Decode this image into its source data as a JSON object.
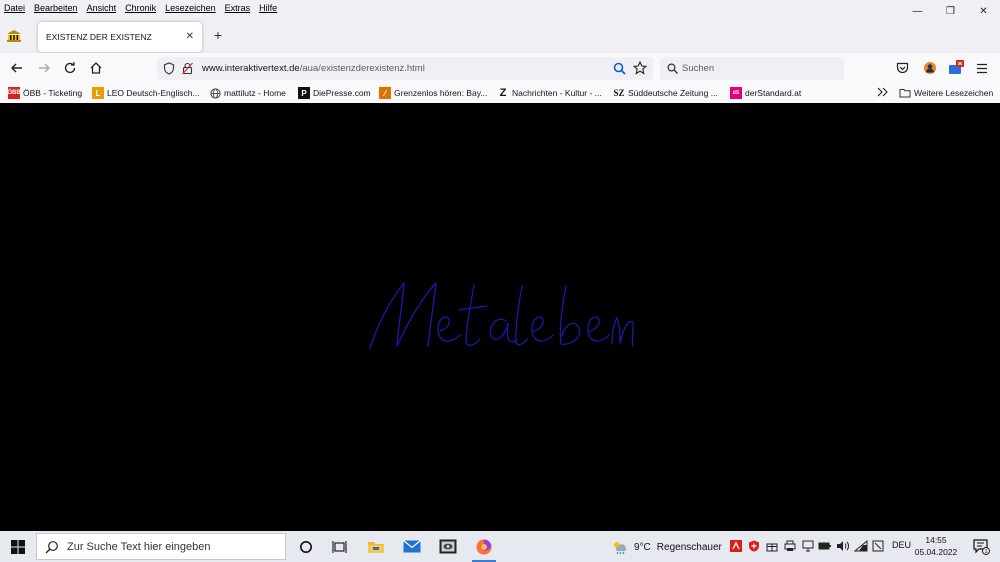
{
  "menubar": [
    "Datei",
    "Bearbeiten",
    "Ansicht",
    "Chronik",
    "Lesezeichen",
    "Extras",
    "Hilfe"
  ],
  "tab": {
    "title": "EXISTENZ DER EXISTENZ"
  },
  "navbar": {
    "url_domain": "www.interaktivertext.de",
    "url_path": "/aua/existenzderexistenz.html",
    "search_placeholder": "Suchen"
  },
  "bookmarks": [
    {
      "label": "ÖBB - Ticketing",
      "icon": "oebb-icon",
      "color": "#d8201c"
    },
    {
      "label": "LEO Deutsch-Englisch...",
      "icon": "leo-icon",
      "color": "#e8a000"
    },
    {
      "label": "mattilutz - Home",
      "icon": "globe-icon",
      "color": "#444444"
    },
    {
      "label": "DiePresse.com",
      "icon": "diepresse-icon",
      "color": "#111111"
    },
    {
      "label": "Grenzenlos hören: Bay...",
      "icon": "br-icon",
      "color": "#e07000"
    },
    {
      "label": "Nachrichten - Kultur - ...",
      "icon": "zeit-icon",
      "color": "#111111"
    },
    {
      "label": "Süddeutsche Zeitung ...",
      "icon": "sz-icon",
      "color": "#111111"
    },
    {
      "label": "derStandard.at",
      "icon": "derstandard-icon",
      "color": "#e6007e"
    }
  ],
  "bookmarks_more": "Weitere Lesezeichen",
  "content": {
    "handwriting": "Metaleben",
    "ink_color": "#1a1aa8"
  },
  "taskbar": {
    "search_placeholder": "Zur Suche Text hier eingeben",
    "weather_temp": "9°C",
    "weather_text": "Regenschauer",
    "language": "DEU",
    "time": "14:55",
    "date": "05.04.2022",
    "notification_count": "1"
  }
}
